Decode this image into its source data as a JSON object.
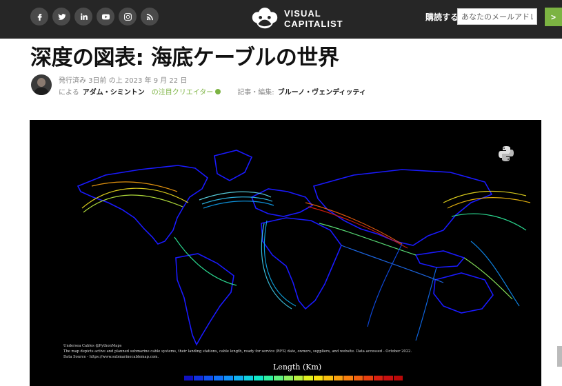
{
  "header": {
    "social_icons": [
      "facebook-icon",
      "twitter-icon",
      "linkedin-icon",
      "youtube-icon",
      "instagram-icon",
      "rss-icon"
    ],
    "logo": {
      "line1": "VISUAL",
      "line2": "CAPITALIST"
    },
    "subscribe_label": "購読する",
    "email_placeholder": "あなたのメールアドレ",
    "submit_label": ">"
  },
  "article": {
    "title": "深度の図表: 海底ケーブルの世界",
    "published": "発行済み 3日前 の上 2023 年 9 月 22 日",
    "by_label": "による",
    "author": "アダム・シミントン",
    "featured_label": "の注目クリエイター",
    "editor_label": "記事・編集:",
    "editor": "ブルーノ・ヴェンディッティ"
  },
  "map": {
    "caption_line1": "Undersea Cables @PythonMaps",
    "caption_line2": "The map depicts active and planned submarine cable systems, their landing stations, cable length, ready for service (RFS) date, owners, suppliers, and website. Data accessed - October 2022.",
    "caption_line3": "Data Source - https://www.submarinecablemap.com.",
    "legend_title": "Length (Km)",
    "legend_colors": [
      "#1010c0",
      "#1030e0",
      "#1050f0",
      "#1070f8",
      "#1090f8",
      "#10b0f0",
      "#10d0e0",
      "#10e8c8",
      "#30f0a0",
      "#60f080",
      "#90f060",
      "#b8f040",
      "#e0f020",
      "#f8e010",
      "#f8c010",
      "#f8a010",
      "#f88010",
      "#f06010",
      "#e84010",
      "#d82010",
      "#c81010",
      "#b80808"
    ]
  }
}
